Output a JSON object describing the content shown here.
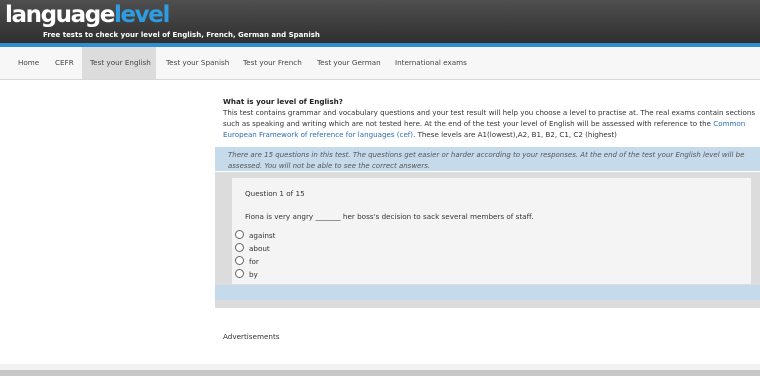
{
  "header": {
    "logo_part1": "language",
    "logo_part2": "level",
    "tagline": "Free tests to check your level of English, French, German and Spanish"
  },
  "nav": {
    "items": [
      {
        "label": "Home"
      },
      {
        "label": "CEFR"
      },
      {
        "label": "Test your English",
        "active": true
      },
      {
        "label": "Test your Spanish"
      },
      {
        "label": "Test your French"
      },
      {
        "label": "Test your German"
      },
      {
        "label": "International exams"
      }
    ]
  },
  "intro": {
    "title": "What is your level of English?",
    "text": "This test contains grammar and vocabulary questions and your test result will help you choose a level to practise at. The real exams contain sections such as speaking and writing which are not tested here. At the end of the test your level of English will be assessed with reference to the",
    "link_text": "Common European Framework of reference for languages (cef)",
    "text_after": ". These levels are A1(lowest),A2, B1, B2, C1, C2 (highest)"
  },
  "notice": {
    "text": "There are 15 questions in this test. The questions get easier or harder according to your responses. At the end of the test your English level will be assessed. You will not be able to see the correct answers."
  },
  "quiz": {
    "counter": "Question 1 of 15",
    "question": "Fiona is very angry _______ her boss's decision to sack several members of staff.",
    "options": [
      "against",
      "about",
      "for",
      "by"
    ]
  },
  "ads_label": "Advertisements",
  "colors": {
    "header_bg": "#3a3a3a",
    "accent_blue": "#2f9be0",
    "panel_blue": "#c5daeb",
    "link": "#2a6fb3"
  }
}
